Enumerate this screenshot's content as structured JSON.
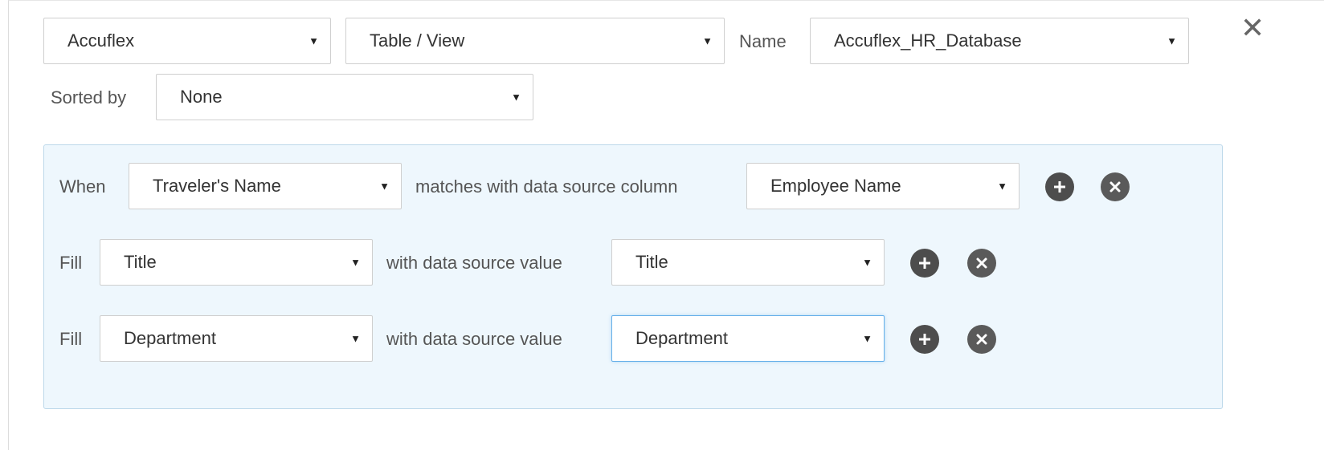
{
  "header": {
    "source_select": "Accuflex",
    "type_select": "Table / View",
    "name_label": "Name",
    "name_select": "Accuflex_HR_Database",
    "sorted_by_label": "Sorted by",
    "sorted_by_select": "None",
    "close_glyph": "✕"
  },
  "rules": {
    "when": {
      "label": "When",
      "field": "Traveler's Name",
      "connector": "matches with data source column",
      "column": "Employee Name"
    },
    "fills": [
      {
        "label": "Fill",
        "field": "Title",
        "connector": "with data source value",
        "value": "Title"
      },
      {
        "label": "Fill",
        "field": "Department",
        "connector": "with data source value",
        "value": "Department"
      }
    ]
  },
  "icons": {
    "caret": "▼",
    "add": "plus-circle-icon",
    "remove": "x-circle-icon"
  },
  "colors": {
    "panel_background": "#eef7fd",
    "panel_border": "#bcd8ea",
    "focus_border": "#66afe9",
    "icon_fill": "#4d4d4d"
  }
}
